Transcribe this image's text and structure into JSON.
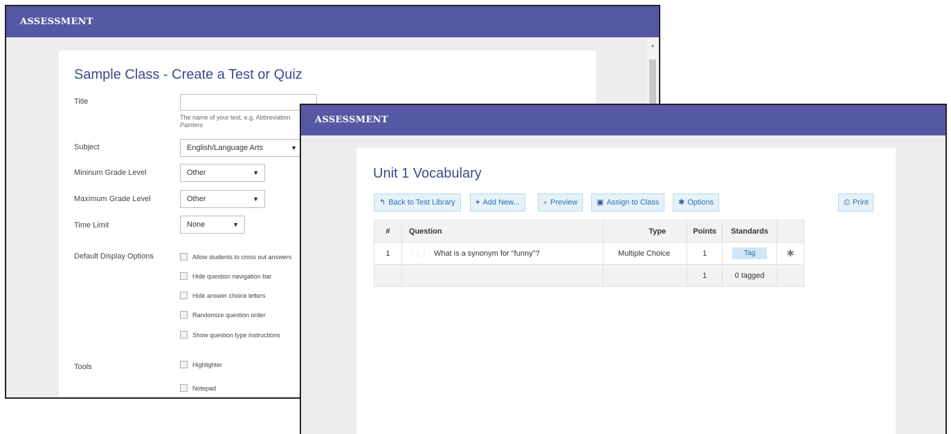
{
  "back_window": {
    "app_title": "ASSESSMENT",
    "page_title": "Sample Class - Create a Test or Quiz",
    "form": {
      "title_label": "Title",
      "title_value": "",
      "title_help_line1": "The name of your test, e.g. Abbreviation",
      "title_help_line2": "Painters",
      "subject_label": "Subject",
      "subject_value": "English/Language Arts",
      "min_grade_label": "Mininum Grade Level",
      "min_grade_value": "Other",
      "max_grade_label": "Maximum Grade Level",
      "max_grade_value": "Other",
      "time_limit_label": "Time Limit",
      "time_limit_value": "None",
      "display_options_label": "Default Display Options",
      "display_options": [
        "Allow students to cross out answers",
        "Hide question navigation bar",
        "Hide answer choice letters",
        "Randomize question order",
        "Show question type instructions"
      ],
      "tools_label": "Tools",
      "tools": [
        "Highlighter",
        "Notepad"
      ]
    }
  },
  "front_window": {
    "app_title": "ASSESSMENT",
    "page_title": "Unit 1 Vocabulary",
    "toolbar": {
      "back": "Back to Test Library",
      "add_new": "Add New...",
      "preview": "Preview",
      "assign": "Assign to Class",
      "options": "Options",
      "print": "Print"
    },
    "table": {
      "headers": [
        "#",
        "Question",
        "Type",
        "Points",
        "Standards"
      ],
      "rows": [
        {
          "num": "1",
          "question": "What is a synonym for \"funny\"?",
          "type": "Multiple Choice",
          "points": "1",
          "standards": "Tag"
        }
      ],
      "footer": {
        "points_total": "1",
        "standards_summary": "0 tagged"
      }
    }
  },
  "colors": {
    "header_bar": "#5658a4",
    "title_text": "#3b4b8c",
    "button_bg": "#e5f2f9",
    "button_text": "#2d6fb5"
  }
}
